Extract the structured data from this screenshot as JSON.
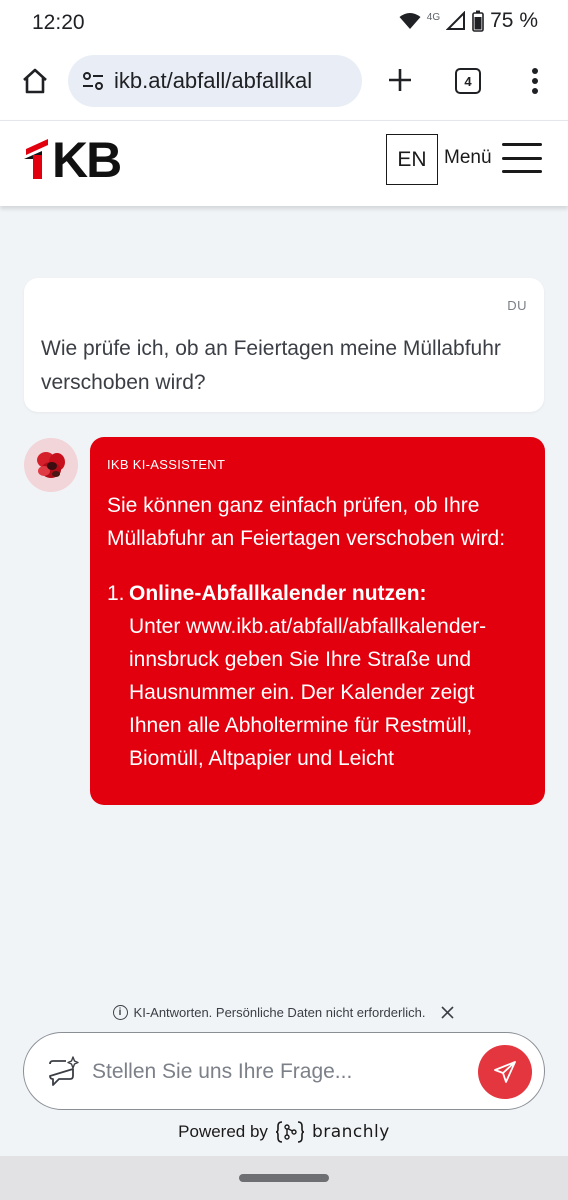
{
  "status_bar": {
    "time": "12:20",
    "network": "4G",
    "battery": "75 %"
  },
  "browser": {
    "url": "ikb.at/abfall/abfallkal",
    "tab_count": "4"
  },
  "site": {
    "logo_text": "KB",
    "lang_button": "EN",
    "menu_label": "Menü",
    "brand_color": "#e2000f"
  },
  "chat": {
    "user_message": {
      "sender": "DU",
      "text": "Wie prüfe ich, ob an Feiertagen meine Müllabfuhr verschoben wird?"
    },
    "bot_message": {
      "sender": "IKB KI-ASSISTENT",
      "intro": "Sie können ganz einfach prüfen, ob Ihre Müllabfuhr an Feiertagen verschoben wird:",
      "items": [
        {
          "number": "1.",
          "heading": "Online-Abfallkalender nutzen:",
          "text": "Unter www.ikb.at/abfall/abfallkalender-innsbruck geben Sie Ihre Straße und Hausnummer ein. Der Kalender zeigt Ihnen alle Abholtermine für Restmüll, Biomüll, Altpapier und Leicht"
        }
      ]
    }
  },
  "disclaimer": {
    "text": "KI-Antworten. Persönliche Daten nicht erforderlich."
  },
  "input": {
    "placeholder": "Stellen Sie uns Ihre Frage..."
  },
  "footer": {
    "powered_by": "Powered by",
    "brand": "branchly"
  }
}
